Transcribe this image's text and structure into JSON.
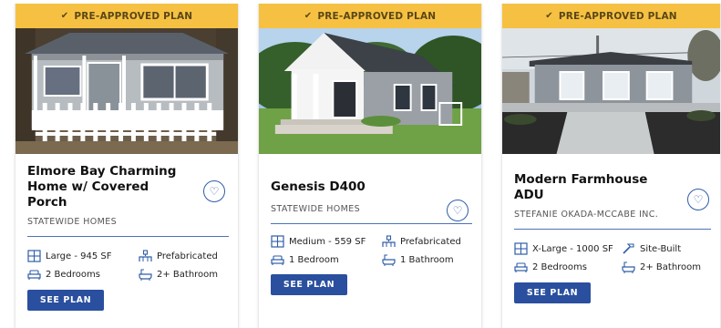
{
  "badge": "PRE-APPROVED PLAN",
  "colors": {
    "banner": "#f6c142",
    "accent": "#2a4f9e",
    "heart": "#2e5da8"
  },
  "cards": [
    {
      "title": "Elmore Bay Charming Home w/ Covered Porch",
      "builder": "STATEWIDE HOMES",
      "size": "Large - 945 SF",
      "type": "Prefabricated",
      "bedrooms": "2 Bedrooms",
      "bathrooms": "2+ Bathroom",
      "button": "SEE PLAN"
    },
    {
      "title": "Genesis D400",
      "builder": "STATEWIDE HOMES",
      "size": "Medium - 559 SF",
      "type": "Prefabricated",
      "bedrooms": "1 Bedroom",
      "bathrooms": "1 Bathroom",
      "button": "SEE PLAN"
    },
    {
      "title": "Modern Farmhouse ADU",
      "builder": "STEFANIE OKADA-MCCABE INC.",
      "size": "X-Large - 1000 SF",
      "type": "Site-Built",
      "bedrooms": "2 Bedrooms",
      "bathrooms": "2+ Bathroom",
      "button": "SEE PLAN"
    }
  ]
}
